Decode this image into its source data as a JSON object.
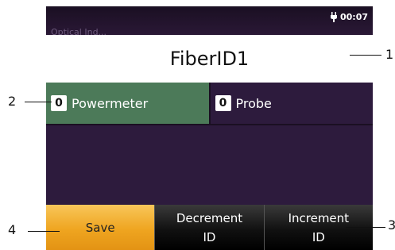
{
  "status": {
    "time": "00:07",
    "ghost_label": "Optical Ind..."
  },
  "header": {
    "title": "FiberID1"
  },
  "tests": [
    {
      "count": "0",
      "label": "Powermeter",
      "active": true
    },
    {
      "count": "0",
      "label": "Probe",
      "active": false
    }
  ],
  "buttons": {
    "save": "Save",
    "decrement_line1": "Decrement",
    "decrement_line2": "ID",
    "increment_line1": "Increment",
    "increment_line2": "ID"
  },
  "callouts": [
    "1",
    "2",
    "3",
    "4"
  ],
  "colors": {
    "background": "#2d1b3d",
    "active_test": "#4c7a59",
    "save_button": "#efa520"
  }
}
